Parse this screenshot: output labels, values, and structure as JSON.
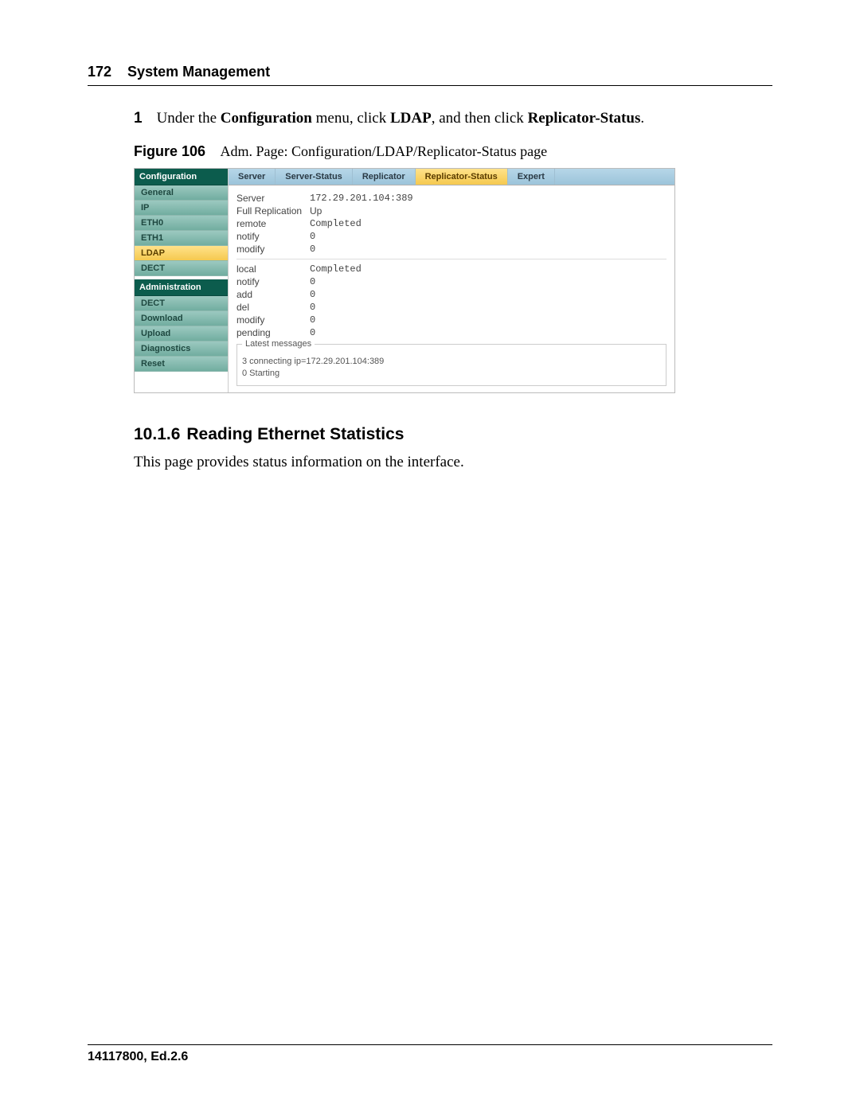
{
  "header": {
    "page_number": "172",
    "chapter_title": "System Management"
  },
  "step": {
    "number": "1",
    "prefix": "Under the ",
    "b1": "Configuration",
    "mid1": " menu, click ",
    "b2": "LDAP",
    "mid2": ", and then click ",
    "b3": "Replicator-Status",
    "suffix": "."
  },
  "figure": {
    "label": "Figure 106",
    "caption": "Adm. Page: Configuration/LDAP/Replicator-Status page"
  },
  "ui": {
    "sidebar": {
      "header1": "Configuration",
      "items1": [
        "General",
        "IP",
        "ETH0",
        "ETH1",
        "LDAP",
        "DECT"
      ],
      "active1": "LDAP",
      "header2": "Administration",
      "items2": [
        "DECT",
        "Download",
        "Upload",
        "Diagnostics",
        "Reset"
      ]
    },
    "tabs": {
      "items": [
        "Server",
        "Server-Status",
        "Replicator",
        "Replicator-Status",
        "Expert"
      ],
      "active": "Replicator-Status"
    },
    "status": {
      "server_label": "Server",
      "server_value": "172.29.201.104:389",
      "fullrep_label": "Full Replication",
      "fullrep_value": "Up",
      "remote_label": "remote",
      "remote_value": "Completed",
      "notify1_label": "notify",
      "notify1_value": "0",
      "modify1_label": "modify",
      "modify1_value": "0",
      "local_label": "local",
      "local_value": "Completed",
      "notify2_label": "notify",
      "notify2_value": "0",
      "add_label": "add",
      "add_value": "0",
      "del_label": "del",
      "del_value": "0",
      "modify2_label": "modify",
      "modify2_value": "0",
      "pending_label": "pending",
      "pending_value": "0"
    },
    "latest": {
      "legend": "Latest messages",
      "messages": [
        "3 connecting ip=172.29.201.104:389",
        "0 Starting"
      ]
    }
  },
  "section": {
    "number": "10.1.6",
    "title": "Reading Ethernet Statistics"
  },
  "body_text": "This page provides status information on the interface.",
  "footer": {
    "docid": "14117800, Ed.2.6"
  }
}
